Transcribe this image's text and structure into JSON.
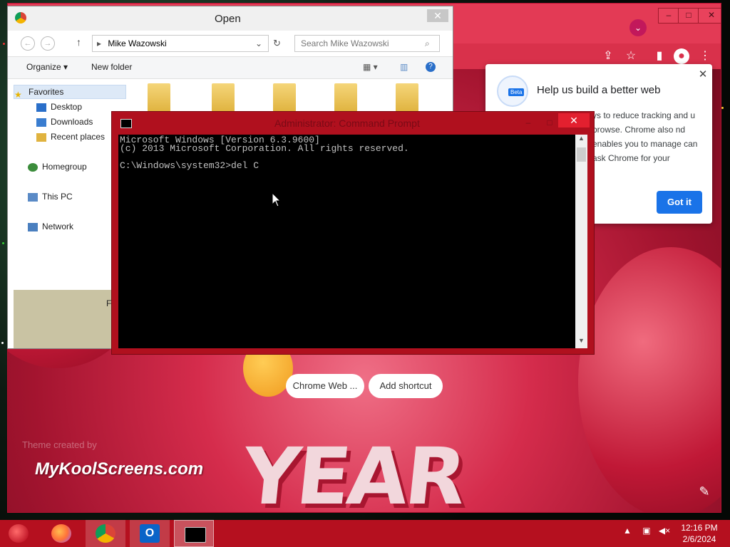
{
  "chrome": {
    "shortcuts": [
      "Chrome Web ...",
      "Add shortcut"
    ],
    "brand_text": "MyKoolScreens.com",
    "theme_credit": "Theme created by",
    "banner_text": "YEAR",
    "popup": {
      "title": "Help us build a better web",
      "body": "ys to reduce tracking and u browse. Chrome also nd enables you to manage can ask Chrome for your",
      "badge": "Beta",
      "button": "Got it"
    }
  },
  "open_dialog": {
    "title": "Open",
    "address": "Mike Wazowski",
    "search_placeholder": "Search Mike Wazowski",
    "organize": "Organize",
    "new_folder": "New folder",
    "nav": {
      "favorites": "Favorites",
      "desktop": "Desktop",
      "downloads": "Downloads",
      "recent": "Recent places",
      "homegroup": "Homegroup",
      "thispc": "This PC",
      "network": "Network"
    },
    "footer_text": "Fi"
  },
  "cmd": {
    "title": "Administrator: Command Prompt",
    "lines": "Microsoft Windows [Version 6.3.9600]\n(c) 2013 Microsoft Corporation. All rights reserved.\n\nC:\\Windows\\system32>del C"
  },
  "taskbar": {
    "time": "12:16 PM",
    "date": "2/6/2024"
  }
}
